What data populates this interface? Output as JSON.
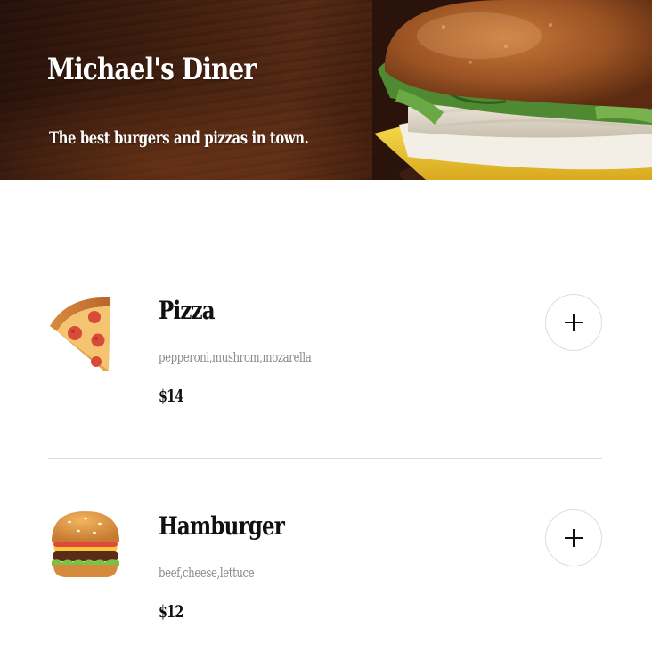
{
  "hero": {
    "title": "Michael's Diner",
    "tagline": "The best burgers and pizzas in town."
  },
  "menu": {
    "items": [
      {
        "name": "Pizza",
        "description": "pepperoni,mushrom,mozarella",
        "price": "$14",
        "icon": "pizza-slice-icon",
        "add_icon": "plus-icon"
      },
      {
        "name": "Hamburger",
        "description": "beef,cheese,lettuce",
        "price": "$12",
        "icon": "hamburger-icon",
        "add_icon": "plus-icon"
      }
    ]
  },
  "colors": {
    "text": "#111111",
    "muted_text": "#8a8a8a",
    "divider": "#dddddd",
    "hero_wood": "#43200f"
  }
}
